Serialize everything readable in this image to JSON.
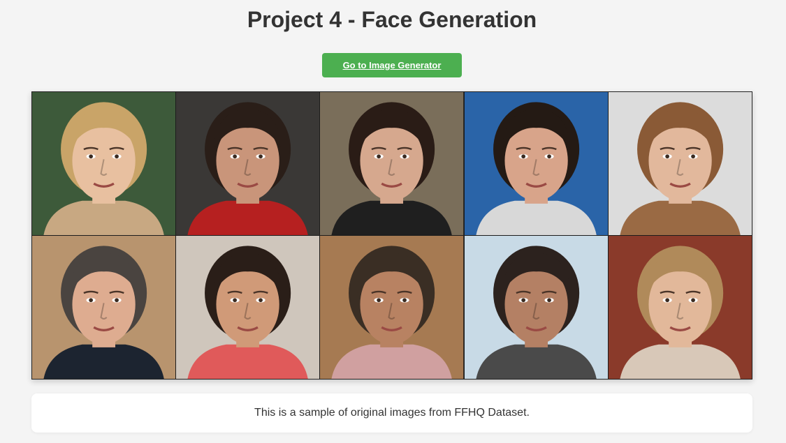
{
  "header": {
    "title": "Project 4 - Face Generation"
  },
  "actions": {
    "generator_link_label": "Go to Image Generator",
    "button_color": "#4caf50"
  },
  "gallery": {
    "tiles": [
      {
        "bg": "#3d5a3a",
        "skin": "#e8c0a0",
        "hair": "#c9a468",
        "shirt": "#c8a882"
      },
      {
        "bg": "#3a3836",
        "skin": "#c9957a",
        "hair": "#2a1e18",
        "shirt": "#b62020"
      },
      {
        "bg": "#7a6e5a",
        "skin": "#d6a88e",
        "hair": "#2a1c16",
        "shirt": "#1f1f1f"
      },
      {
        "bg": "#2a64a8",
        "skin": "#d8a48a",
        "hair": "#241a14",
        "shirt": "#d8d8d8"
      },
      {
        "bg": "#dcdcdc",
        "skin": "#e2b89c",
        "hair": "#8a5a36",
        "shirt": "#9a6a44"
      },
      {
        "bg": "#b8946e",
        "skin": "#deac90",
        "hair": "#4a4440",
        "shirt": "#1c2430"
      },
      {
        "bg": "#cfc6bc",
        "skin": "#d09a78",
        "hair": "#2a1e18",
        "shirt": "#e05a5a"
      },
      {
        "bg": "#a67a52",
        "skin": "#b88262",
        "hair": "#3a2e24",
        "shirt": "#d0a0a0"
      },
      {
        "bg": "#c8dae6",
        "skin": "#b48064",
        "hair": "#2c221e",
        "shirt": "#4a4a4a"
      },
      {
        "bg": "#8a3a2a",
        "skin": "#e2b89a",
        "hair": "#b08a5a",
        "shirt": "#d8c8b8"
      }
    ]
  },
  "caption": {
    "text": "This is a sample of original images from FFHQ Dataset."
  }
}
